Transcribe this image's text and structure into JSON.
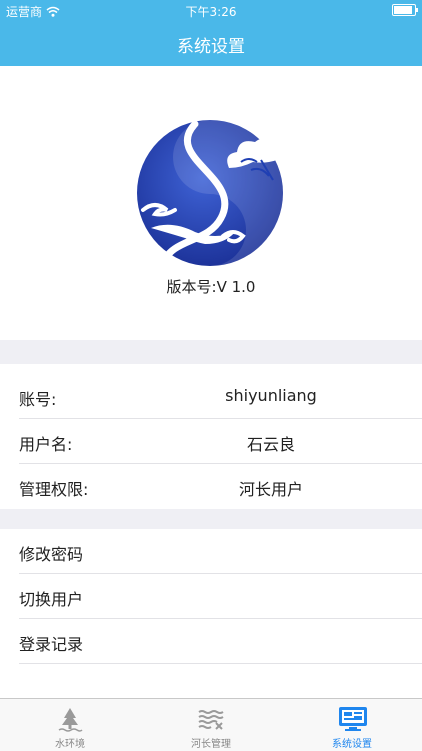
{
  "status_bar": {
    "carrier": "运营商",
    "time": "下午3:26",
    "battery_level": 0.9
  },
  "nav": {
    "title": "系统设置"
  },
  "app_info": {
    "version": "版本号:V  1.0"
  },
  "account": [
    {
      "label": "账号:",
      "value": "shiyunliang"
    },
    {
      "label": "用户名:",
      "value": "石云良"
    },
    {
      "label": "管理权限:",
      "value": "河长用户"
    }
  ],
  "actions": [
    {
      "label": "修改密码"
    },
    {
      "label": "切换用户"
    },
    {
      "label": "登录记录"
    }
  ],
  "tabs": [
    {
      "label": "水环境",
      "icon": "water-environment-icon",
      "active": false
    },
    {
      "label": "河长管理",
      "icon": "river-management-icon",
      "active": false
    },
    {
      "label": "系统设置",
      "icon": "system-settings-icon",
      "active": true
    }
  ],
  "colors": {
    "accent": "#4ab8e9",
    "tab_active": "#1f86ee",
    "logo_blue": "#1f3fb3"
  }
}
